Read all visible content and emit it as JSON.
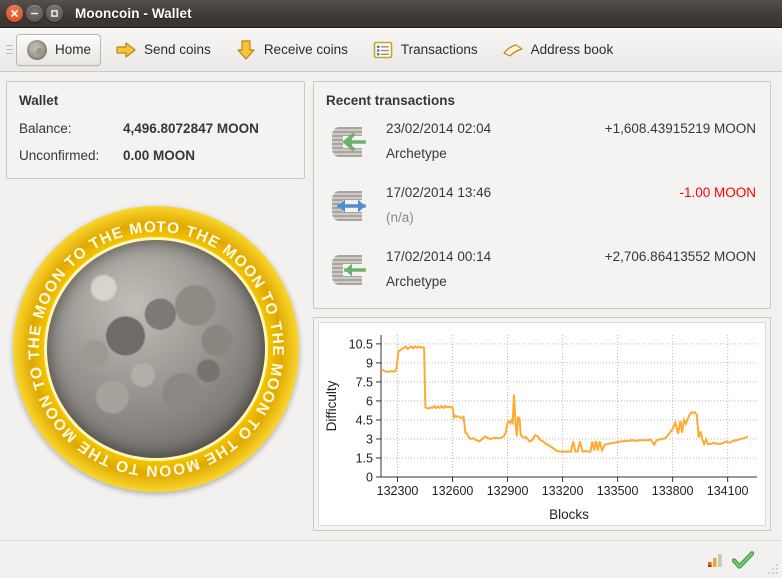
{
  "window": {
    "title": "Mooncoin - Wallet",
    "controls": [
      {
        "name": "close",
        "glyph": "×"
      },
      {
        "name": "minimize",
        "glyph": "−"
      },
      {
        "name": "maximize",
        "glyph": "□"
      }
    ]
  },
  "toolbar": {
    "items": [
      {
        "label": "Home",
        "icon": "moon-icon",
        "active": true
      },
      {
        "label": "Send coins",
        "icon": "arrow-right-icon",
        "active": false
      },
      {
        "label": "Receive coins",
        "icon": "arrow-down-icon",
        "active": false
      },
      {
        "label": "Transactions",
        "icon": "list-icon",
        "active": false
      },
      {
        "label": "Address book",
        "icon": "book-icon",
        "active": false
      }
    ]
  },
  "wallet": {
    "title": "Wallet",
    "balance_label": "Balance:",
    "balance_value": "4,496.8072847 MOON",
    "unconfirmed_label": "Unconfirmed:",
    "unconfirmed_value": "0.00 MOON"
  },
  "coin": {
    "ring_text": "TO THE MOON TO THE MOON TO THE MOON TO THE MOON TO THE MOON TO THE MOON ",
    "ring_color": "#ffd400",
    "alt": "mooncoin-logo"
  },
  "transactions": {
    "title": "Recent transactions",
    "rows": [
      {
        "direction": "incoming",
        "icon": "incoming-arrow-icon",
        "date": "23/02/2014 02:04",
        "address": "Archetype",
        "amount": "+1,608.43915219 MOON",
        "negative": false
      },
      {
        "direction": "self",
        "icon": "self-transfer-icon",
        "date": "17/02/2014 13:46",
        "address": "(n/a)",
        "amount": "-1.00 MOON",
        "negative": true
      },
      {
        "direction": "incoming",
        "icon": "incoming-arrow-icon",
        "date": "17/02/2014 00:14",
        "address": "Archetype",
        "amount": "+2,706.86413552 MOON",
        "negative": false
      }
    ]
  },
  "statusbar": {
    "connection_icon": "signal-bars-icon",
    "sync_icon": "green-check-icon",
    "resize_grip_icon": "resize-grip-icon"
  },
  "chart_data": {
    "type": "line",
    "title": "",
    "xlabel": "Blocks",
    "ylabel": "Difficulty",
    "line_color": "#ffaa33",
    "grid": true,
    "legend": "none",
    "xlim": [
      132210,
      134260
    ],
    "ylim": [
      0,
      11.2
    ],
    "xticks": [
      132300,
      132600,
      132900,
      133200,
      133500,
      133800,
      134100
    ],
    "yticks": [
      0,
      1.5,
      3,
      4.5,
      6,
      7.5,
      9,
      10.5
    ],
    "x": [
      132210,
      132225,
      132240,
      132255,
      132270,
      132285,
      132295,
      132305,
      132315,
      132325,
      132335,
      132345,
      132355,
      132365,
      132375,
      132385,
      132395,
      132405,
      132415,
      132425,
      132435,
      132445,
      132452,
      132460,
      132470,
      132480,
      132490,
      132500,
      132510,
      132520,
      132530,
      132540,
      132550,
      132560,
      132570,
      132580,
      132590,
      132600,
      132608,
      132615,
      132622,
      132630,
      132640,
      132650,
      132660,
      132670,
      132680,
      132690,
      132700,
      132715,
      132730,
      132745,
      132760,
      132775,
      132790,
      132805,
      132820,
      132835,
      132850,
      132865,
      132880,
      132890,
      132900,
      132908,
      132915,
      132922,
      132928,
      132935,
      132942,
      132950,
      132958,
      132965,
      132972,
      132980,
      132990,
      133000,
      133010,
      133020,
      133035,
      133050,
      133065,
      133080,
      133095,
      133110,
      133125,
      133140,
      133155,
      133170,
      133185,
      133200,
      133215,
      133230,
      133245,
      133258,
      133270,
      133282,
      133295,
      133310,
      133325,
      133340,
      133352,
      133362,
      133372,
      133382,
      133392,
      133402,
      133415,
      133430,
      133445,
      133460,
      133480,
      133500,
      133520,
      133540,
      133560,
      133580,
      133600,
      133620,
      133640,
      133660,
      133680,
      133700,
      133712,
      133725,
      133740,
      133760,
      133780,
      133800,
      133815,
      133830,
      133842,
      133852,
      133862,
      133872,
      133882,
      133892,
      133902,
      133912,
      133922,
      133932,
      133942,
      133952,
      133962,
      133972,
      133982,
      133992,
      134002,
      134012,
      134022,
      134035,
      134050,
      134070,
      134090,
      134110,
      134130,
      134150,
      134170,
      134190,
      134210,
      134230,
      134250
    ],
    "y": [
      8.5,
      8.4,
      8.3,
      8.3,
      8.35,
      8.3,
      8.6,
      9.9,
      10.0,
      10.1,
      10.2,
      10.3,
      10.1,
      10.2,
      10.3,
      10.15,
      10.3,
      10.2,
      10.3,
      10.2,
      10.25,
      10.2,
      5.5,
      5.45,
      5.4,
      5.5,
      5.45,
      5.6,
      5.45,
      5.55,
      5.45,
      5.6,
      5.45,
      5.6,
      5.5,
      5.55,
      5.5,
      5.5,
      4.7,
      4.8,
      4.75,
      4.8,
      4.7,
      4.65,
      4.75,
      3.5,
      3.4,
      3.1,
      3.0,
      3.05,
      2.9,
      2.8,
      2.95,
      3.2,
      3.1,
      3.0,
      3.05,
      3.1,
      3.05,
      3.1,
      3.2,
      3.5,
      4.3,
      4.4,
      4.25,
      4.45,
      4.3,
      6.5,
      4.6,
      3.2,
      4.7,
      4.65,
      3.3,
      3.2,
      3.1,
      3.15,
      3.0,
      2.8,
      2.9,
      3.3,
      3.2,
      2.9,
      2.8,
      2.6,
      2.5,
      2.35,
      2.2,
      2.05,
      2.0,
      2.0,
      2.0,
      2.0,
      2.0,
      2.8,
      2.0,
      2.0,
      2.8,
      2.0,
      2.05,
      2.0,
      2.0,
      2.8,
      2.1,
      2.85,
      2.1,
      2.8,
      2.1,
      2.55,
      2.6,
      2.65,
      2.7,
      2.75,
      2.8,
      2.85,
      2.85,
      2.9,
      2.85,
      2.9,
      2.9,
      2.9,
      2.95,
      2.55,
      2.9,
      2.95,
      3.0,
      3.05,
      3.4,
      3.8,
      4.3,
      3.4,
      4.4,
      3.5,
      4.5,
      4.2,
      4.55,
      4.9,
      5.1,
      5.05,
      5.1,
      4.9,
      3.1,
      3.6,
      2.95,
      2.6,
      2.95,
      2.6,
      2.6,
      2.6,
      2.7,
      2.65,
      2.6,
      2.65,
      2.8,
      2.7,
      2.85,
      2.9,
      3.0,
      3.05,
      3.2
    ]
  }
}
